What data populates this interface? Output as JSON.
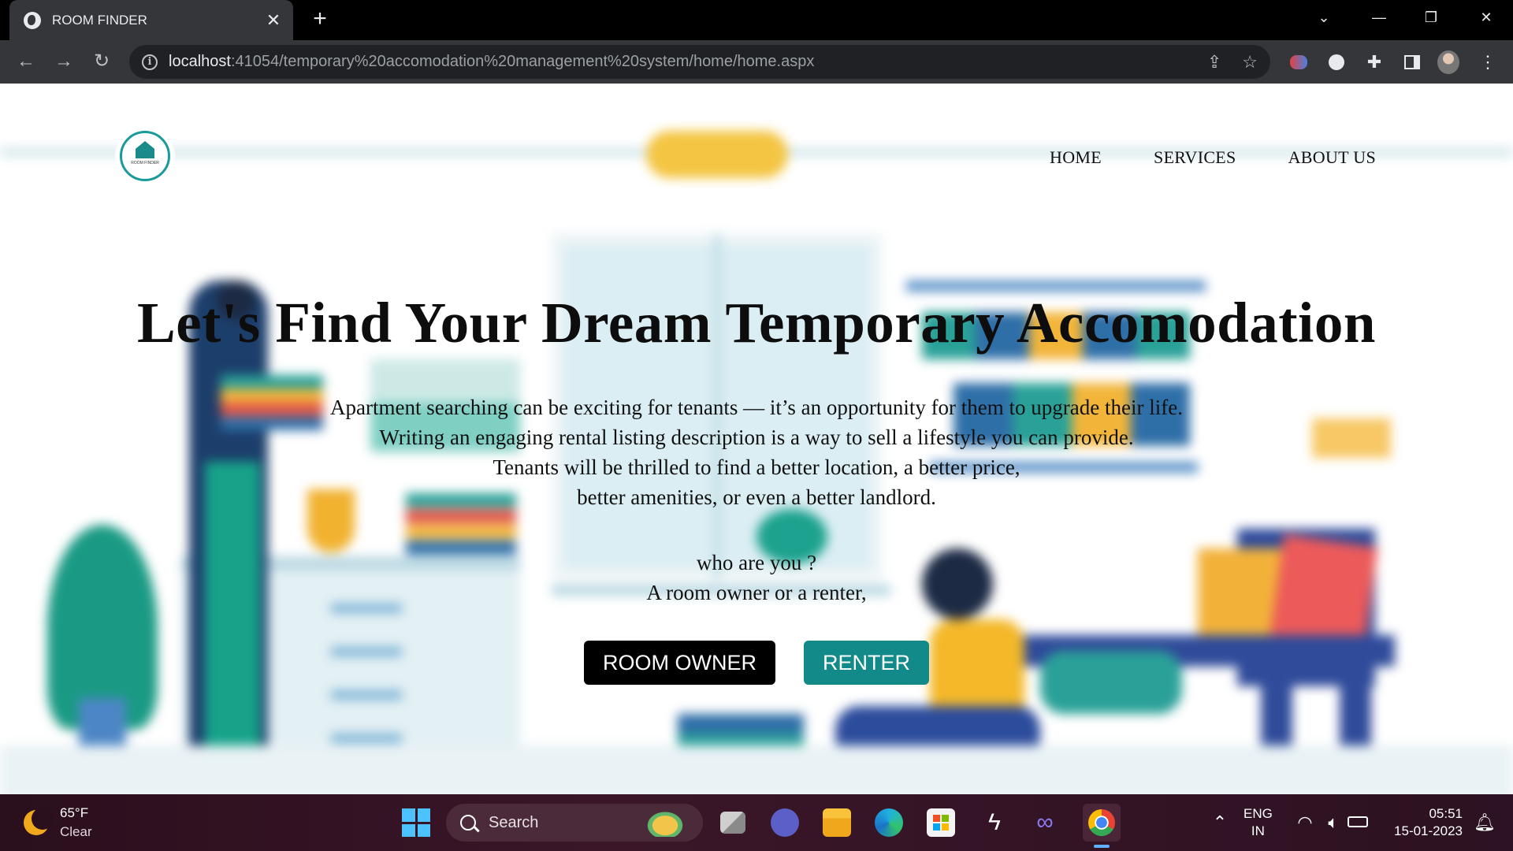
{
  "browser": {
    "tab_title": "ROOM FINDER",
    "tab_close": "✕",
    "new_tab": "+",
    "url_host": "localhost",
    "url_path": ":41054/temporary%20accomodation%20management%20system/home/home.aspx"
  },
  "site": {
    "logo_text": "ROOM FINDER",
    "nav": [
      "HOME",
      "SERVICES",
      "ABOUT US"
    ],
    "hero_title": "Let's Find Your Dream Temporary Accomodation",
    "description": [
      "Apartment searching can be exciting for tenants — it’s an opportunity for them to upgrade their life.",
      "Writing an engaging rental listing description is a way to sell a lifestyle you can provide.",
      "Tenants will be thrilled to find a better location, a better price,",
      "better amenities, or even a better landlord."
    ],
    "question": [
      "who are you ?",
      "A room owner or a renter,"
    ],
    "buttons": {
      "owner": "ROOM OWNER",
      "renter": "RENTER"
    }
  },
  "taskbar": {
    "weather_temp": "65°F",
    "weather_condition": "Clear",
    "search_label": "Search",
    "language": "ENG",
    "region": "IN",
    "time": "05:51",
    "date": "15-01-2023"
  },
  "colors": {
    "accent": "#128a8a",
    "owner_button": "#000000"
  }
}
